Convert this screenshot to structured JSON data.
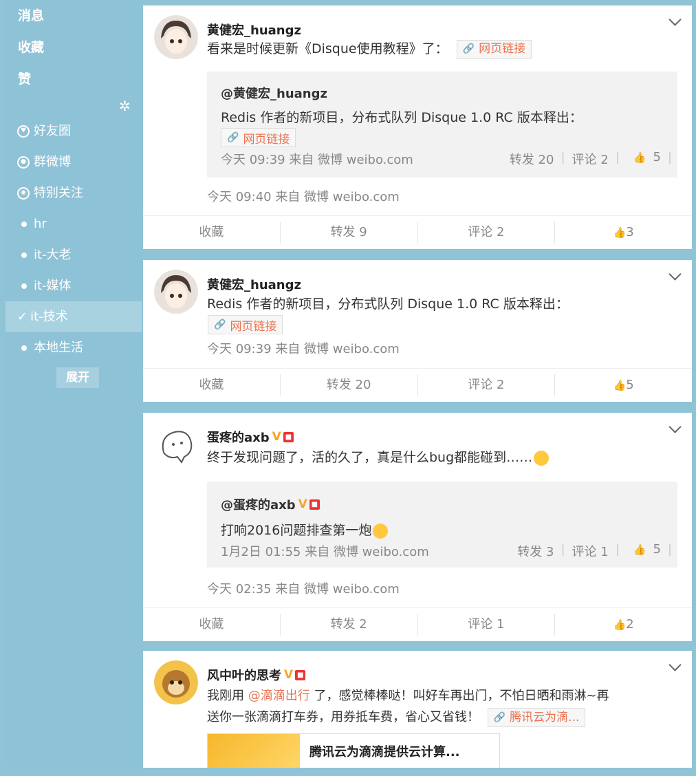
{
  "sidebar": {
    "top_items": [
      "消息",
      "收藏",
      "赞"
    ],
    "groups": [
      {
        "label": "好友圈",
        "icon": "heart-circle-icon"
      },
      {
        "label": "群微博",
        "icon": "people-circle-icon"
      },
      {
        "label": "特别关注",
        "icon": "eye-circle-icon"
      },
      {
        "label": "hr",
        "icon": "dot-icon"
      },
      {
        "label": "it-大老",
        "icon": "dot-icon"
      },
      {
        "label": "it-媒体",
        "icon": "dot-icon"
      },
      {
        "label": "it-技术",
        "icon": "check-icon",
        "active": true
      },
      {
        "label": "本地生活",
        "icon": "dot-icon"
      }
    ],
    "expand_label": "展开"
  },
  "posts": [
    {
      "author": "黄健宏_huangz",
      "text": "看来是时候更新《Disque使用教程》了：",
      "link_label": "网页链接",
      "quote": {
        "author": "@黄健宏_huangz",
        "text": "Redis 作者的新项目，分布式队列 Disque 1.0 RC 版本释出：",
        "link_label": "网页链接",
        "meta": "今天 09:39 来自 微博 weibo.com",
        "repost": "转发 20",
        "comment": "评论 2",
        "like": "5"
      },
      "meta": "今天 09:40 来自 微博 weibo.com",
      "actions": {
        "fav": "收藏",
        "repost": "转发 9",
        "comment": "评论 2",
        "like": "3"
      }
    },
    {
      "author": "黄健宏_huangz",
      "text": "Redis 作者的新项目，分布式队列 Disque 1.0 RC 版本释出：",
      "link_label": "网页链接",
      "meta": "今天 09:39 来自 微博 weibo.com",
      "actions": {
        "fav": "收藏",
        "repost": "转发 20",
        "comment": "评论 2",
        "like": "5"
      }
    },
    {
      "author": "蛋疼的axb",
      "text": "终于发现问题了，活的久了，真是什么bug都能碰到……",
      "quote": {
        "author": "@蛋疼的axb",
        "text": "打响2016问题排查第一炮",
        "meta": "1月2日 01:55 来自 微博 weibo.com",
        "repost": "转发 3",
        "comment": "评论 1",
        "like": "5"
      },
      "meta": "今天 02:35 来自 微博 weibo.com",
      "actions": {
        "fav": "收藏",
        "repost": "转发 2",
        "comment": "评论 1",
        "like": "2"
      }
    },
    {
      "author": "风中叶的思考",
      "text_before": "我刚用 ",
      "mention": "@滴滴出行",
      "text_after": " 了，感觉棒棒哒！叫好车再出门，不怕日晒和雨淋~再",
      "text_line2": "送你一张滴滴打车券，用券抵车费，省心又省钱！",
      "link_label": "腾讯云为滴...",
      "preview_title": "腾讯云为滴滴提供云计算..."
    }
  ],
  "colors": {
    "accent": "#eb7350",
    "sidebar": "#8ec2d6",
    "vbadge": "#f5a623"
  }
}
